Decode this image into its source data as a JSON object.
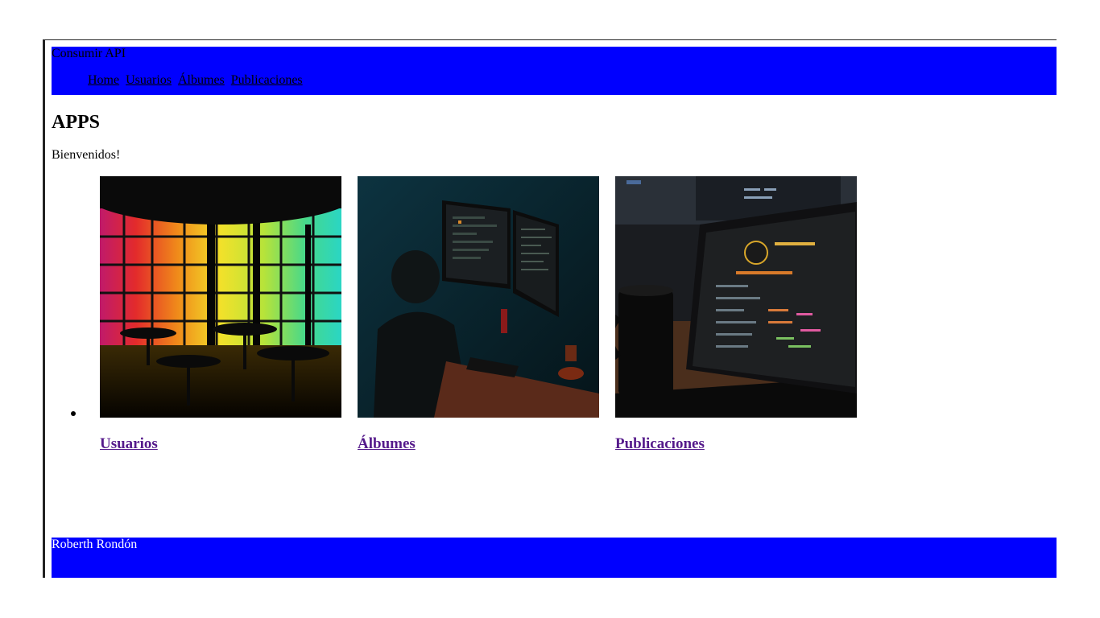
{
  "header": {
    "brand": "Consumir API",
    "nav": [
      "Home",
      "Usuarios",
      "Álbumes",
      "Publicaciones"
    ]
  },
  "main": {
    "title": "APPS",
    "welcome": "Bienvenidos!",
    "cards": [
      {
        "label": "Usuarios",
        "image": "rainbow-lit-restaurant-photo"
      },
      {
        "label": "Álbumes",
        "image": "developer-at-dual-monitors-photo"
      },
      {
        "label": "Publicaciones",
        "image": "laptop-code-and-mug-photo"
      }
    ]
  },
  "footer": {
    "author": "Roberth Rondón"
  },
  "colors": {
    "bar": "#0000ff",
    "visited_link": "#551a8b"
  }
}
